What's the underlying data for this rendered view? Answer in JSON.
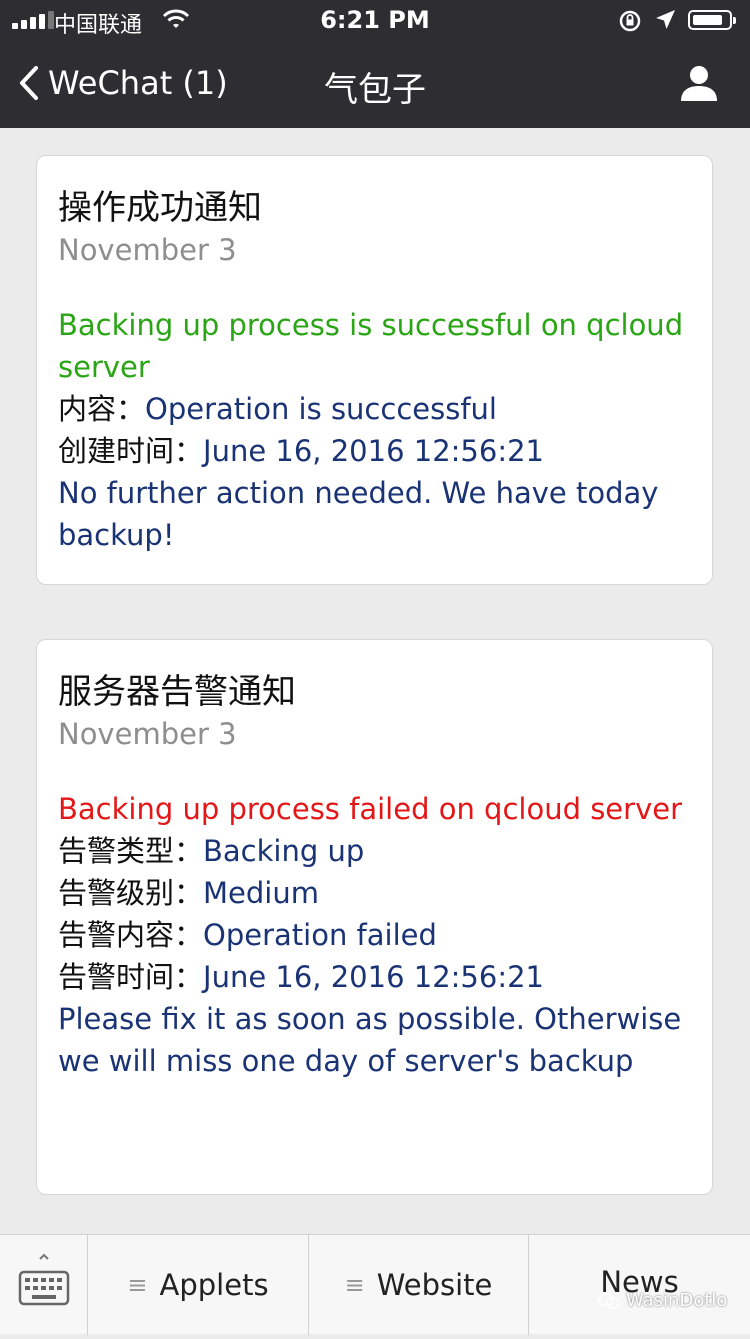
{
  "status": {
    "carrier": "中国联通",
    "time": "6:21 PM",
    "icons": [
      "signal-icon",
      "wifi-icon",
      "rotation-lock-icon",
      "location-icon",
      "battery-icon"
    ]
  },
  "nav": {
    "back_label": "WeChat (1)",
    "title": "气包子",
    "icons": [
      "back-chevron-icon",
      "profile-icon"
    ]
  },
  "cards": [
    {
      "title": "操作成功通知",
      "date": "November 3",
      "headline": "Backing up process is successful on qcloud server",
      "headline_color": "#2aa515",
      "fields": [
        {
          "label": "内容：",
          "value": "Operation is succcessful"
        },
        {
          "label": "创建时间：",
          "value": "June 16, 2016 12:56:21"
        }
      ],
      "footer": "No further action needed. We have today backup!"
    },
    {
      "title": "服务器告警通知",
      "date": "November 3",
      "headline": "Backing up process failed on qcloud server",
      "headline_color": "#e31717",
      "fields": [
        {
          "label": "告警类型：",
          "value": "Backing up"
        },
        {
          "label": "告警级别：",
          "value": "Medium"
        },
        {
          "label": "告警内容：",
          "value": "Operation failed"
        },
        {
          "label": "告警时间：",
          "value": "June 16, 2016 12:56:21"
        }
      ],
      "footer": "Please fix it as soon as possible. Otherwise we will miss one day of server's backup"
    }
  ],
  "bottom_menu": {
    "keyboard_icon": "keyboard-icon",
    "items": [
      {
        "label": "Applets",
        "icon": "menu-icon"
      },
      {
        "label": "Website",
        "icon": "menu-icon"
      },
      {
        "label": "News"
      }
    ]
  },
  "watermark": "WasinDotlo",
  "colors": {
    "nav_bg": "#2e2e32",
    "page_bg": "#ebebeb",
    "value_text": "#1a3375",
    "date_text": "#8e8e8e"
  }
}
